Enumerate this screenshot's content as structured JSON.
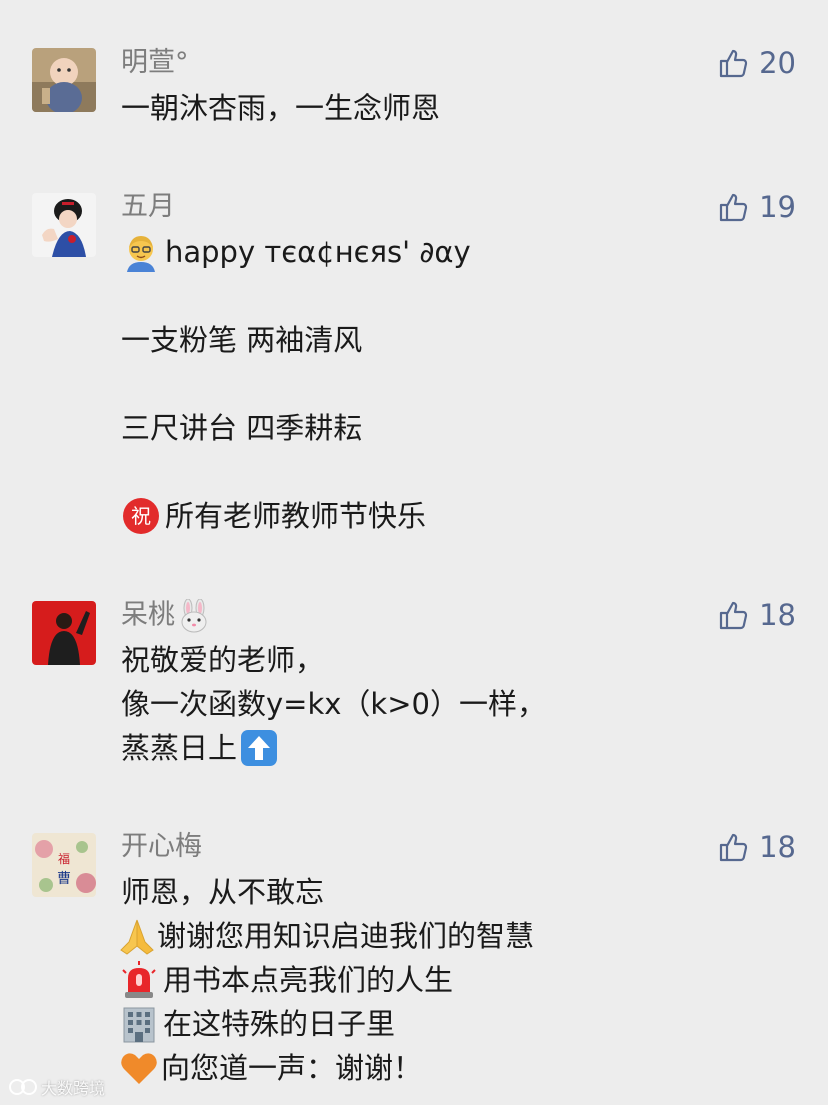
{
  "comments": [
    {
      "username": "明萱°",
      "likes": "20",
      "lines": [
        "一朝沐杏雨，一生念师恩"
      ]
    },
    {
      "username": "五月",
      "likes": "19",
      "lines": [
        "happy тєα¢нєяѕ' ∂αy",
        "一支粉笔 两袖清风",
        "三尺讲台 四季耕耘",
        "所有老师教师节快乐"
      ],
      "emoji": [
        "teacher-emoji",
        "congratulations-emoji"
      ]
    },
    {
      "username": "呆桃",
      "username_emoji": "rabbit-face-emoji",
      "likes": "18",
      "lines": [
        "祝敬爱的老师，",
        "像一次函数y=kx（k>0）一样，",
        "蒸蒸日上"
      ],
      "emoji": [
        "up-arrow-emoji"
      ]
    },
    {
      "username": "开心梅",
      "likes": "18",
      "lines": [
        "师恩，从不敢忘",
        "谢谢您用知识启迪我们的智慧",
        "用书本点亮我们的人生",
        "在这特殊的日子里",
        "向您道一声：谢谢！"
      ],
      "emoji": [
        "folded-hands-emoji",
        "siren-light-emoji",
        "office-building-emoji",
        "orange-heart-emoji"
      ]
    }
  ],
  "watermark": "大数跨境",
  "colors": {
    "background": "#ededed",
    "username": "#7d7d7d",
    "like": "#56688f",
    "text": "#1a1a1a"
  }
}
